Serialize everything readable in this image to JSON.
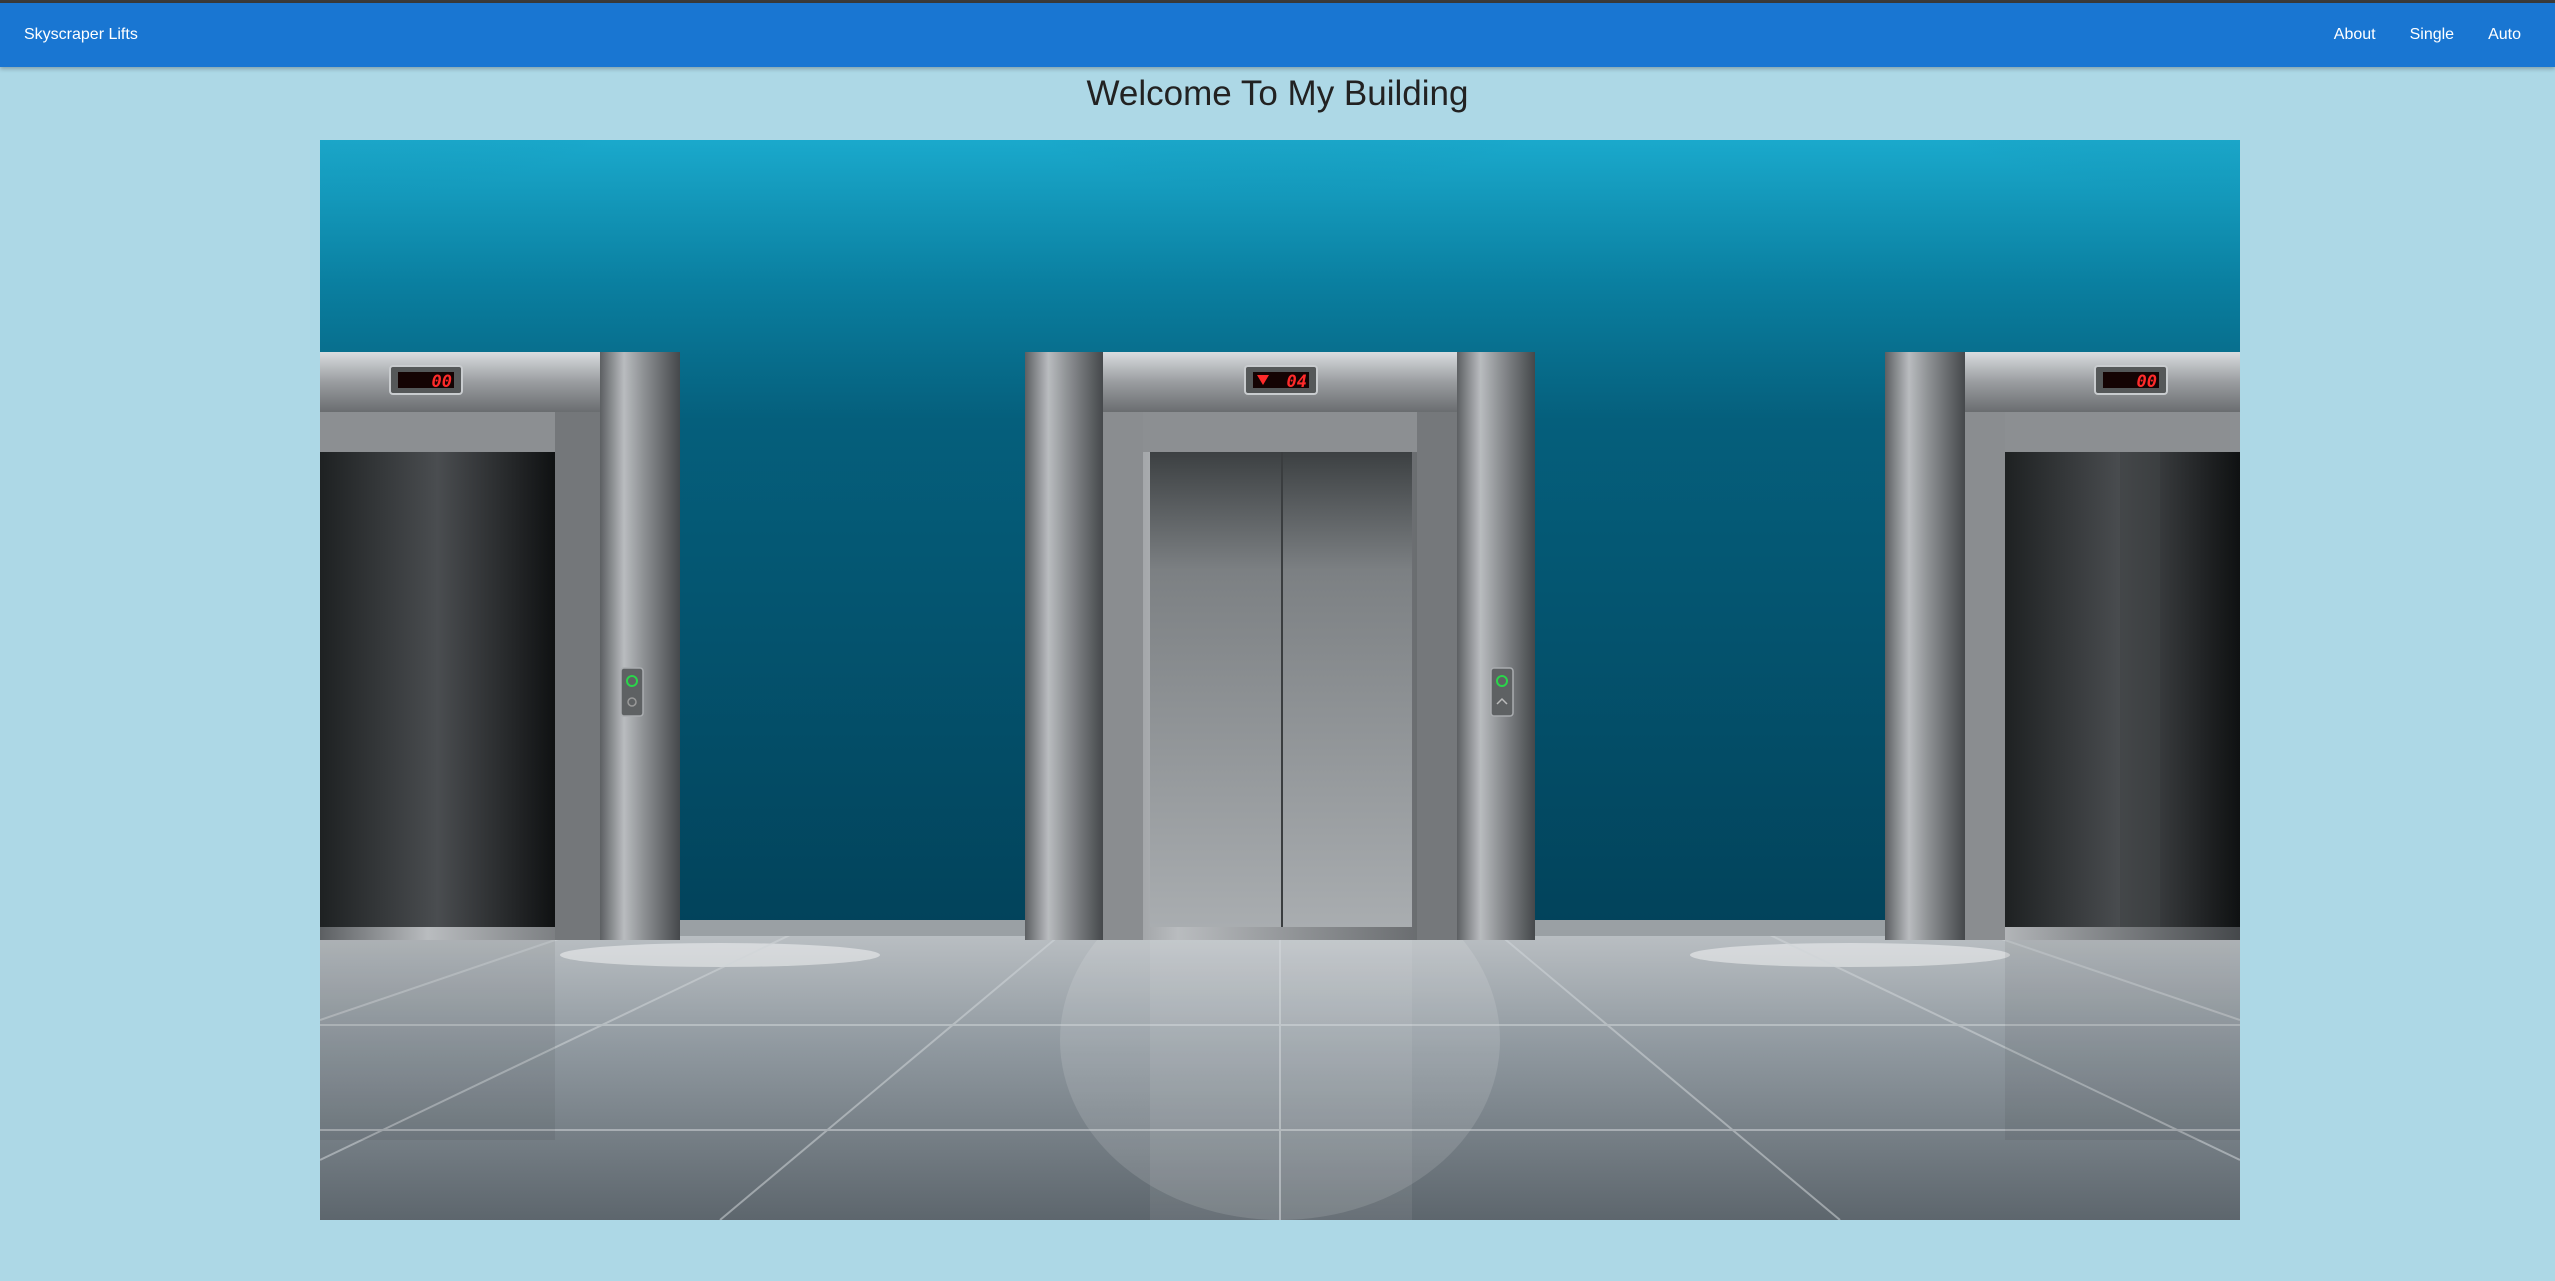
{
  "navbar": {
    "brand": "Skyscraper Lifts",
    "links": [
      "About",
      "Single",
      "Auto"
    ]
  },
  "page": {
    "title": "Welcome To My Building"
  },
  "elevators": [
    {
      "position": "left",
      "display": "00",
      "direction": ""
    },
    {
      "position": "center",
      "display": "04",
      "direction": "down"
    },
    {
      "position": "right",
      "display": "00",
      "direction": ""
    }
  ],
  "colors": {
    "navbar": "#1976d2",
    "background": "#add8e6",
    "wall": "#045a74",
    "display_red": "#ff2a2a"
  }
}
